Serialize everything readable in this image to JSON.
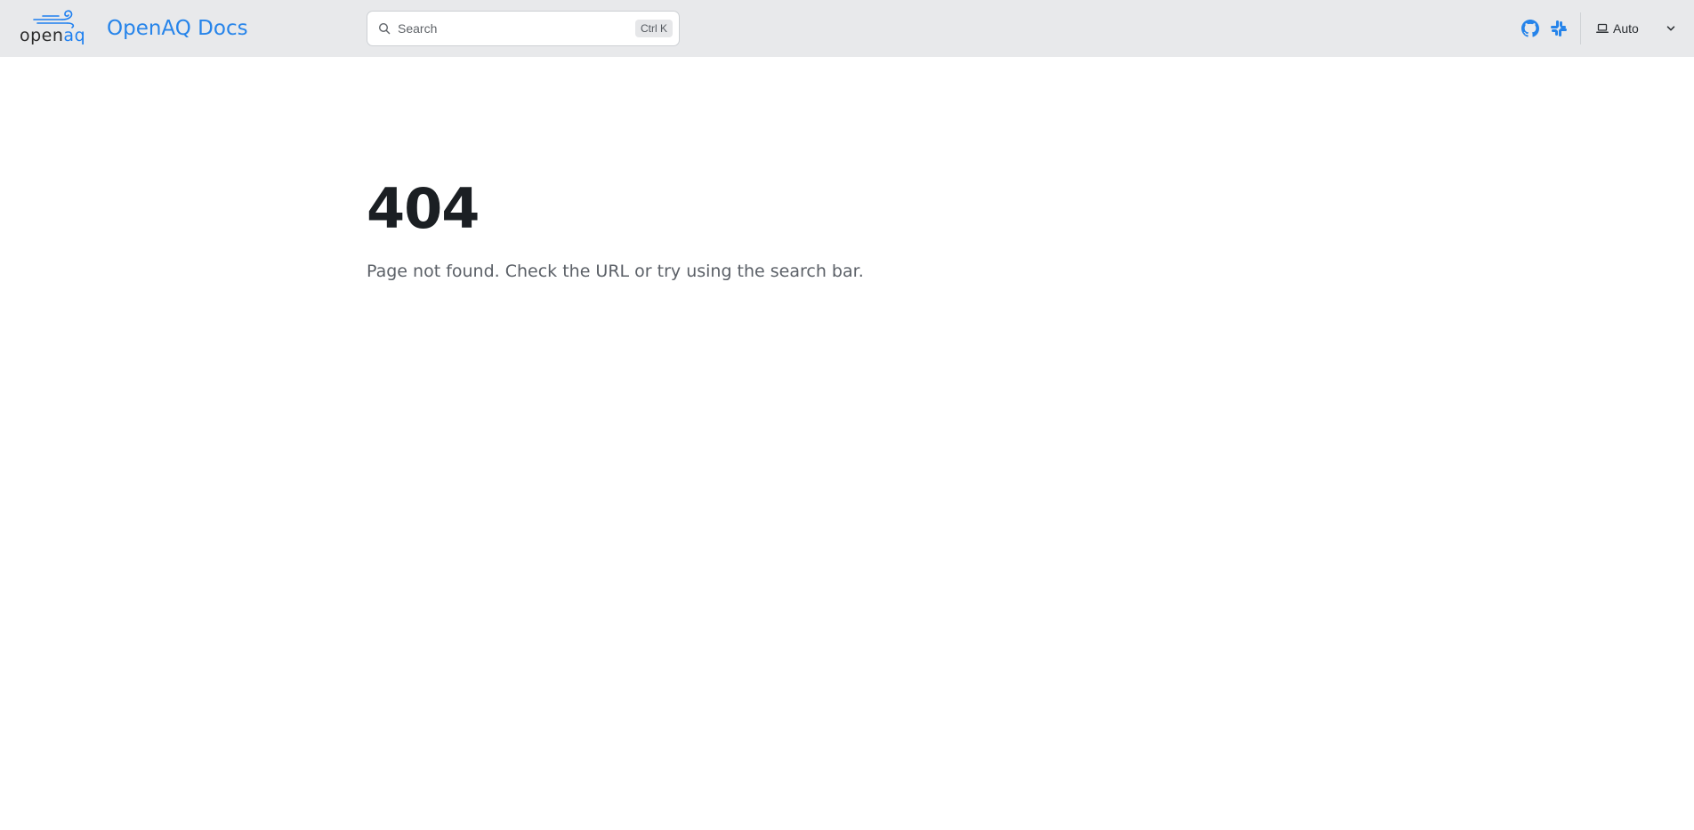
{
  "navbar": {
    "logo": {
      "wordmark_dark": "open",
      "wordmark_blue": "aq",
      "icon": "openaq-wind-logo-icon"
    },
    "site_title": "OpenAQ Docs",
    "search": {
      "placeholder": "Search",
      "shortcut": "Ctrl K",
      "icon": "search-icon"
    },
    "links": [
      {
        "icon": "github-icon"
      },
      {
        "icon": "slack-icon"
      }
    ],
    "theme": {
      "label": "Auto",
      "icon": "laptop-icon",
      "dropdown_icon": "chevron-down-icon"
    }
  },
  "main": {
    "error_code": "404",
    "message": "Page not found. Check the URL or try using the search bar."
  },
  "colors": {
    "brand_blue": "#2684ea",
    "navbar_bg": "#e8e9eb",
    "heading": "#1b1f23",
    "body_text": "#5b6067"
  }
}
